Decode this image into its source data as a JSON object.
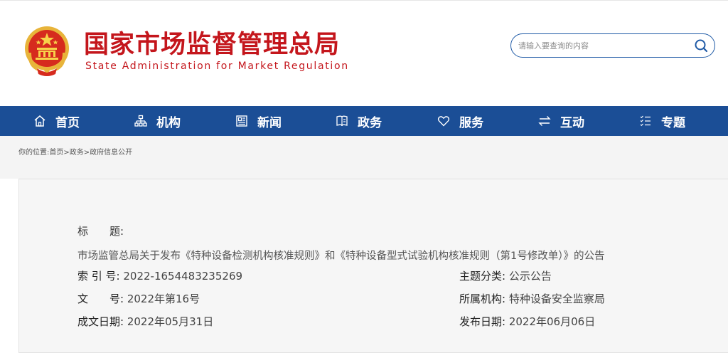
{
  "header": {
    "brand_cn": "国家市场监督管理总局",
    "brand_en": "State Administration for Market Regulation",
    "emblem_icon": "national-emblem-icon"
  },
  "search": {
    "placeholder": "请输入要查询的内容",
    "icon": "search-icon"
  },
  "nav": {
    "items": [
      {
        "label": "首页",
        "icon": "home-icon"
      },
      {
        "label": "机构",
        "icon": "org-chart-icon"
      },
      {
        "label": "新闻",
        "icon": "newspaper-icon"
      },
      {
        "label": "政务",
        "icon": "book-icon"
      },
      {
        "label": "服务",
        "icon": "heart-icon"
      },
      {
        "label": "互动",
        "icon": "exchange-icon"
      },
      {
        "label": "专题",
        "icon": "list-icon"
      }
    ],
    "background": "#1b4e96"
  },
  "breadcrumb": {
    "prefix": "你的位置:",
    "items": [
      "首页",
      "政务",
      "政府信息公开"
    ],
    "separator": ">"
  },
  "doc_info": {
    "title_label": "标　　题:",
    "title_value": "市场监管总局关于发布《特种设备检测机构核准规则》和《特种设备型式试验机构核准规则（第1号修改单）》的公告",
    "index_label": "索 引 号:",
    "index_value": "2022-1654483235269",
    "category_label": "主题分类:",
    "category_value": "公示公告",
    "doc_no_label": "文　　号:",
    "doc_no_value": "2022年第16号",
    "agency_label": "所属机构:",
    "agency_value": "特种设备安全监察局",
    "created_label": "成文日期:",
    "created_value": "2022年05月31日",
    "published_label": "发布日期:",
    "published_value": "2022年06月06日"
  },
  "colors": {
    "brand_red": "#c4161c",
    "nav_blue": "#1b4e96"
  }
}
